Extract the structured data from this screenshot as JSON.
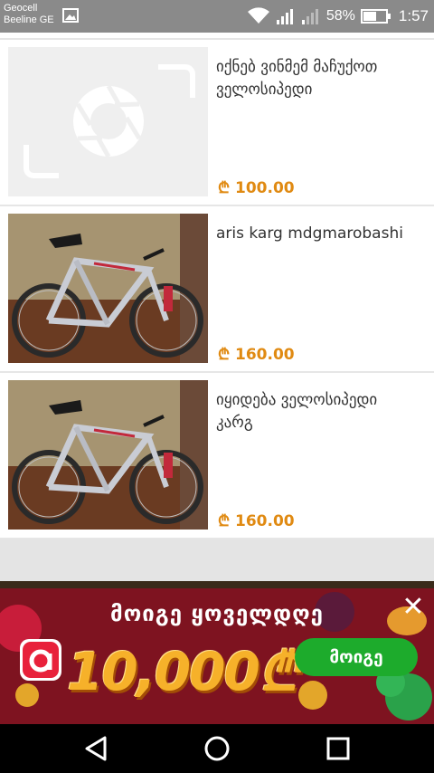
{
  "status_bar": {
    "carrier_1": "Geocell",
    "carrier_2": "Beeline GE",
    "battery": "58%",
    "time": "1:57"
  },
  "listings": [
    {
      "title": "იქნებ ვინმემ მაჩუქოთ ველოსიპედი",
      "price": "₾ 100.00",
      "image": "placeholder-camera-icon"
    },
    {
      "title": "aris karg mdgmarobashi",
      "price": "₾ 160.00",
      "image": "bicycle-photo"
    },
    {
      "title": "იყიდება ველოსიპედი კარგ",
      "price": "₾ 160.00",
      "image": "bicycle-photo"
    }
  ],
  "ad": {
    "headline": "მოიგე ყოველდღე",
    "amount": "10,000₾",
    "button_label": "მოიგე",
    "close_label": "✕"
  },
  "colors": {
    "price": "#e08a12",
    "status_bar": "#8a8a8a",
    "ad_background": "#7e1320",
    "ad_button": "#1dab2c"
  }
}
